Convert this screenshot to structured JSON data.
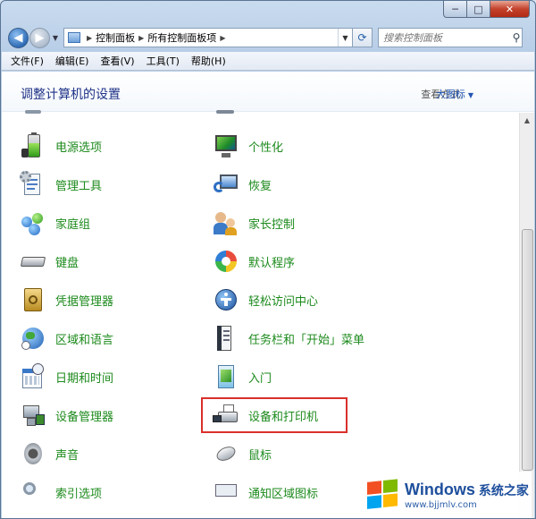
{
  "window": {
    "caption_buttons": {
      "minimize": "─",
      "maximize": "□",
      "close": "✕"
    }
  },
  "navigation": {
    "back_glyph": "◀",
    "forward_glyph": "▶",
    "breadcrumb": [
      "控制面板",
      "所有控制面板项"
    ],
    "search_placeholder": "搜索控制面板"
  },
  "menubar": [
    "文件(F)",
    "编辑(E)",
    "查看(V)",
    "工具(T)",
    "帮助(H)"
  ],
  "header": {
    "title": "调整计算机的设置",
    "view_by_label": "查看方式:",
    "view_by_value": "大图标"
  },
  "items_left": [
    {
      "label": "电源选项",
      "icon": "battery-power-icon"
    },
    {
      "label": "管理工具",
      "icon": "admin-tools-icon"
    },
    {
      "label": "家庭组",
      "icon": "homegroup-icon"
    },
    {
      "label": "键盘",
      "icon": "keyboard-icon"
    },
    {
      "label": "凭据管理器",
      "icon": "credential-vault-icon"
    },
    {
      "label": "区域和语言",
      "icon": "globe-clock-icon"
    },
    {
      "label": "日期和时间",
      "icon": "calendar-clock-icon"
    },
    {
      "label": "设备管理器",
      "icon": "device-manager-icon"
    },
    {
      "label": "声音",
      "icon": "speaker-icon"
    },
    {
      "label": "索引选项",
      "icon": "index-search-icon"
    }
  ],
  "items_right": [
    {
      "label": "个性化",
      "icon": "monitor-paint-icon"
    },
    {
      "label": "恢复",
      "icon": "recovery-icon"
    },
    {
      "label": "家长控制",
      "icon": "parental-controls-icon"
    },
    {
      "label": "默认程序",
      "icon": "default-programs-icon"
    },
    {
      "label": "轻松访问中心",
      "icon": "ease-of-access-icon"
    },
    {
      "label": "任务栏和「开始」菜单",
      "icon": "taskbar-icon"
    },
    {
      "label": "入门",
      "icon": "getting-started-icon"
    },
    {
      "label": "设备和打印机",
      "icon": "printer-icon"
    },
    {
      "label": "鼠标",
      "icon": "mouse-icon"
    },
    {
      "label": "通知区域图标",
      "icon": "notification-area-icon"
    }
  ],
  "highlighted_item": "设备和打印机",
  "watermark": {
    "brand": "Windows",
    "site": "系统之家",
    "url": "www.bjjmlv.com",
    "colors": [
      "#f25022",
      "#7fba00",
      "#00a4ef",
      "#ffb900"
    ]
  },
  "colors": {
    "title_blue": "#1e3287",
    "link_green": "#1c8a1c",
    "highlight_red": "#d9302c"
  }
}
